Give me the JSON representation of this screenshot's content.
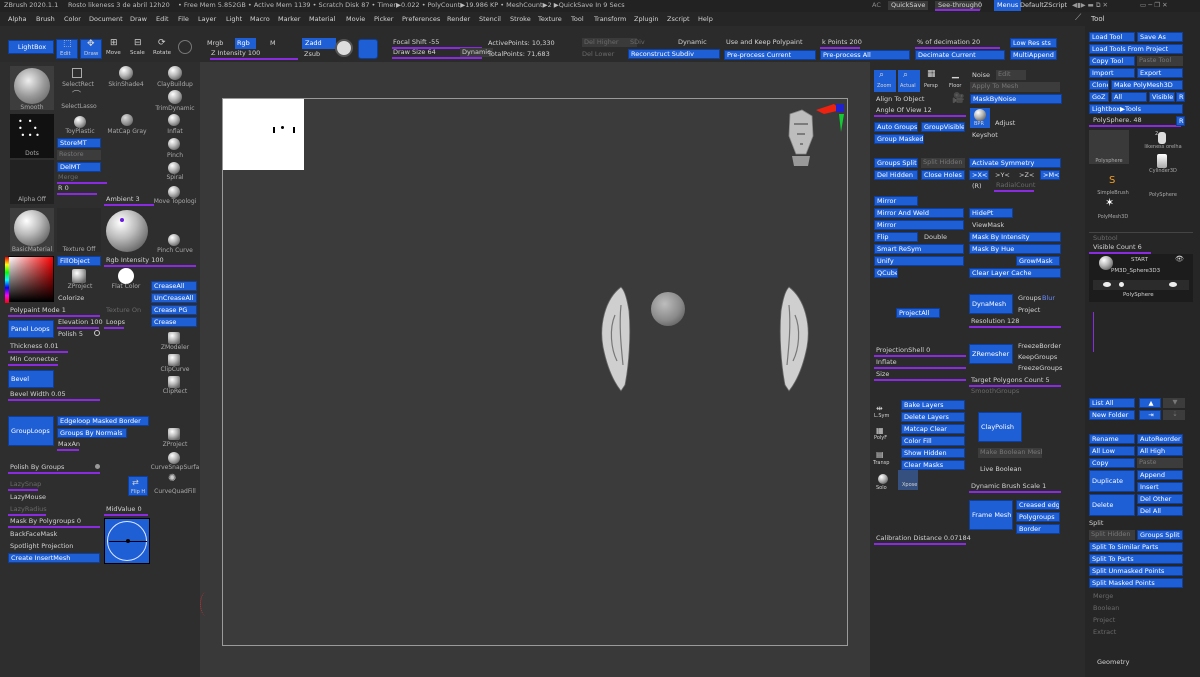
{
  "status": {
    "title": "ZBrush 2020.1.1",
    "doc": "Rosto likeness 3 de abril 12h20",
    "mem": "• Free Mem 5.852GB • Active Mem 1139 • Scratch Disk 87 • Timer▶0.022 • PolyCount▶19.986 KP • MeshCount▶2 ▶QuickSave In 9 Secs",
    "ac": "AC",
    "quicksave": "QuickSave",
    "seethrough": "See-through",
    "seevalue": "0",
    "menus": "Menus",
    "script": "DefaultZScript"
  },
  "menus": [
    "Alpha",
    "Brush",
    "Color",
    "Document",
    "Draw",
    "Edit",
    "File",
    "Layer",
    "Light",
    "Macro",
    "Marker",
    "Material",
    "Movie",
    "Picker",
    "Preferences",
    "Render",
    "Stencil",
    "Stroke",
    "Texture",
    "Tool",
    "Transform",
    "Zplugin",
    "Zscript",
    "Help"
  ],
  "toolbar": {
    "lightbox": "LightBox",
    "edit": "Edit",
    "draw": "Draw",
    "move": "Move",
    "scale": "Scale",
    "rotate": "Rotate",
    "mrgb": "Mrgb",
    "rgb": "Rgb",
    "m": "M",
    "zadd": "Zadd",
    "zsub": "Zsub",
    "zint": "Z Intensity 100",
    "focal": "Focal Shift -55",
    "drawsize": "Draw Size 64",
    "dynamic": "Dynamic",
    "active": "ActivePoints: 10,330",
    "total": "TotalPoints: 71,683",
    "delhigher": "Del Higher",
    "sdiv": "SDiv",
    "dynamic2": "Dynamic",
    "reconstruct": "Reconstruct Subdiv",
    "dellower": "Del Lower",
    "keeppoly": "Use and Keep Polypaint",
    "preprocess": "Pre-process Current",
    "kpoints": "k Points 200",
    "preall": "Pre-process All",
    "pdecim": "% of decimation 20",
    "decimate": "Decimate Current",
    "lowres": "Low Res sts",
    "multiappend": "MultiAppend"
  },
  "left": {
    "brushes": [
      "Smooth",
      "SelectRect",
      "SkinShade4",
      "ClayBuildup",
      "SelectLasso",
      "TrimDynamic",
      "Dots",
      "ToyPlastic",
      "MatCap Gray",
      "Inflat",
      "StoreMT",
      "Pinch",
      "Alpha Off",
      "Texture Off",
      "BasicMaterial",
      "Spiral",
      "Move Topologi",
      "Pinch Curve",
      "ZProject",
      "Flat Color",
      "ZModeler",
      "ClipCurve",
      "ClipRect",
      "ZProject",
      "CurveSnapSurfa",
      "CurveQuadFill"
    ],
    "restoremt": "Restore",
    "delmt": "DelMT",
    "merge": "Merge",
    "rval": "R 0",
    "ambient": "Ambient 3",
    "rgbint": "Rgb Intensity 100",
    "fillobject": "FillObject",
    "colorize": "Colorize",
    "createall": "CreaseAll",
    "uncreaseall": "UnCreaseAll",
    "creasepg": "Crease PG",
    "crease": "Crease",
    "polypaint": "Polypaint Mode 1",
    "textureon": "Texture On",
    "panelloops": "Panel Loops",
    "elevation": "Elevation 100",
    "loops": "Loops",
    "polish": "Polish 5",
    "thickness": "Thickness 0.01",
    "minconn": "Min Connectec",
    "bevel": "Bevel",
    "bevelw": "Bevel Width 0.05",
    "edgeloop": "Edgeloop Masked Border",
    "groupsnormals": "Groups By Normals",
    "maxan": "MaxAn",
    "grouploops": "GroupLoops",
    "polishgroups": "Polish By Groups",
    "lazysnap": "LazySnap",
    "lazymouse": "LazyMouse",
    "lazyradius": "LazyRadius",
    "midvalue": "MidValue 0",
    "maskpoly": "Mask By Polygroups 0",
    "backface": "BackFaceMask",
    "spotlight": "Spotlight Projection",
    "createinsert": "Create InsertMesh",
    "flipH": "Flip H"
  },
  "right": {
    "zoom": "Zoom",
    "actual": "Actual",
    "persp": "Persp",
    "floor": "Floor",
    "noise": "Noise",
    "edit": "Edit",
    "applymesh": "Apply To Mesh",
    "aligntoobject": "Align To Object",
    "angleofview": "Angle Of View 12",
    "bpr": "BPR",
    "maskbynoise": "MaskByNoise",
    "adjust": "Adjust",
    "keyshot": "Keyshot",
    "autogroups": "Auto Groups",
    "groupvisible": "GroupVisible",
    "groupmasked": "Group Masked",
    "groupssplit": "Groups Split",
    "splithidden": "Split Hidden",
    "activatesym": "Activate Symmetry",
    "delhidden": "Del Hidden",
    "closeholes": "Close Holes",
    "x": ">X<",
    "y": ">Y<",
    "z": ">Z<",
    "m": ">M<",
    "r": "(R)",
    "radialcount": "RadialCount",
    "mirror": "Mirror",
    "mirrorweld": "Mirror And Weld",
    "mirror2": "Mirror",
    "flip": "Flip",
    "double": "Double",
    "smartresym": "Smart ReSym",
    "unify": "Unify",
    "qcube": "QCube",
    "hidept": "HidePt",
    "viewmask": "ViewMask",
    "maskintensity": "Mask By Intensity",
    "maskhue": "Mask By Hue",
    "growmask": "GrowMask",
    "clearlayer": "Clear Layer Cache",
    "projectall": "ProjectAll",
    "dynamesh": "DynaMesh",
    "groups": "Groups",
    "blur": "Blur",
    "project": "Project",
    "resolution": "Resolution 128",
    "projshell": "ProjectionShell 0",
    "inflate": "Inflate",
    "size": "Size",
    "zremesher": "ZRemesher",
    "freezeborder": "FreezeBorder",
    "keepgroups": "KeepGroups",
    "freezegroups": "FreezeGroups",
    "targetpoly": "Target Polygons Count 5",
    "smoothgroups": "SmoothGroups",
    "lsym": "L.Sym",
    "polyf": "PolyF",
    "transp": "Transp",
    "solo": "Solo",
    "xpose": "Xpose",
    "bakelayers": "Bake Layers",
    "deletelayers": "Delete Layers",
    "matcapclear": "Matcap Clear",
    "colorfill": "Color Fill",
    "showhidden": "Show Hidden",
    "clearmasks": "Clear Masks",
    "claypolish": "ClayPolish",
    "makeboolean": "Make Boolean Mesh",
    "liveboolean": "Live Boolean",
    "dynamicbrush": "Dynamic Brush Scale 1",
    "framemesh": "Frame Mesh",
    "creasededge": "Creased edge",
    "polygroups": "Polygroups",
    "border": "Border",
    "calibration": "Calibration Distance 0.07184"
  },
  "tray": {
    "tool": "Tool",
    "loadtool": "Load Tool",
    "saveas": "Save As",
    "loadproject": "Load Tools From Project",
    "copytool": "Copy Tool",
    "pastetool": "Paste Tool",
    "import": "Import",
    "export": "Export",
    "clone": "Clone",
    "makepolymesh": "Make PolyMesh3D",
    "goz": "GoZ",
    "all": "All",
    "visible": "Visible",
    "r": "R",
    "lightboxtools": "Lightbox▶Tools",
    "polysphere": "PolySphere. 48",
    "count": "2",
    "thumbs": [
      "Polysphere",
      "likeness orelha",
      "SimpleBrush",
      "Cylinder3D",
      "PolyMesh3D",
      "PolySphere"
    ],
    "subtool": "Subtool",
    "visiblecount": "Visible Count 6",
    "start": "START",
    "pm3d": "PM3D_Sphere3D3",
    "polysphere2": "PolySphere",
    "listall": "List All",
    "newfolder": "New Folder",
    "rename": "Rename",
    "autoreorder": "AutoReorder",
    "alllow": "All Low",
    "allhigh": "All High",
    "copy": "Copy",
    "paste": "Paste",
    "duplicate": "Duplicate",
    "append": "Append",
    "insert": "Insert",
    "delete": "Delete",
    "delother": "Del Other",
    "delall": "Del All",
    "split": "Split",
    "splithidden": "Split Hidden",
    "groupssplit": "Groups Split",
    "splitsimilar": "Split To Similar Parts",
    "splitparts": "Split To Parts",
    "splitunmasked": "Split Unmasked Points",
    "splitmasked": "Split Masked Points",
    "merge": "Merge",
    "boolean": "Boolean",
    "project": "Project",
    "extract": "Extract",
    "geometry": "Geometry"
  }
}
